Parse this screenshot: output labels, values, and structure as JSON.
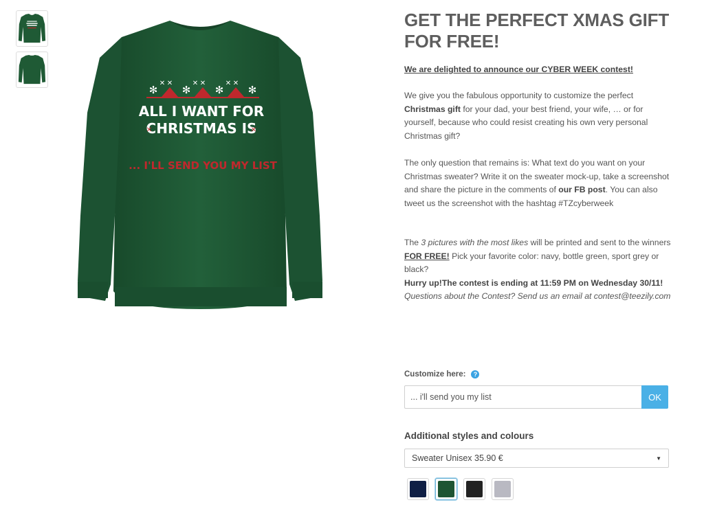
{
  "thumbnails": [
    {
      "label": "front-view"
    },
    {
      "label": "back-view"
    }
  ],
  "product": {
    "sweater_color": "#1f5a35",
    "print_line1": "ALL I WANT FOR",
    "print_line2": "CHRISTMAS IS",
    "print_line3": "... I'LL SEND YOU MY LIST"
  },
  "title": "GET THE PERFECT XMAS GIFT FOR FREE!",
  "announcement": "We are delighted to announce our CYBER WEEK contest!",
  "paragraph1": {
    "a": "We give you the fabulous opportunity to customize the perfect ",
    "b": "Christmas gift",
    "c": " for your dad, your best friend, your wife, … or for yourself, because who could resist creating his own very personal Christmas gift?"
  },
  "paragraph2": {
    "a": "The only question that remains is: What text do you want on your Christmas sweater? Write it on the sweater mock-up, take a screenshot and share the picture in the comments of ",
    "b": "our FB post",
    "c": ". You can also tweet us the screenshot with the hashtag #TZcyberweek"
  },
  "paragraph3": {
    "a": "The ",
    "b": "3 pictures with the most likes",
    "c": " will be printed and sent to the winners ",
    "d": "FOR FREE!",
    "e": " Pick your favorite color: navy, bottle green, sport grey or black?",
    "f": "Hurry up!The contest is ending at 11:59 PM on Wednesday 30/11!",
    "g": "Questions about the Contest? Send us an email at contest@teezily.com"
  },
  "customize": {
    "label": "Customize here:",
    "help_icon": "?",
    "input_value": "... i'll send you my list",
    "ok_label": "OK"
  },
  "styles": {
    "heading": "Additional styles and colours",
    "selected_option": "Sweater Unisex 35.90 €"
  },
  "colors": [
    {
      "name": "navy",
      "hex": "#0f1f45",
      "selected": false
    },
    {
      "name": "bottle green",
      "hex": "#1e5533",
      "selected": true
    },
    {
      "name": "black",
      "hex": "#222222",
      "selected": false
    },
    {
      "name": "sport grey",
      "hex": "#b9b9c2",
      "selected": false
    }
  ]
}
